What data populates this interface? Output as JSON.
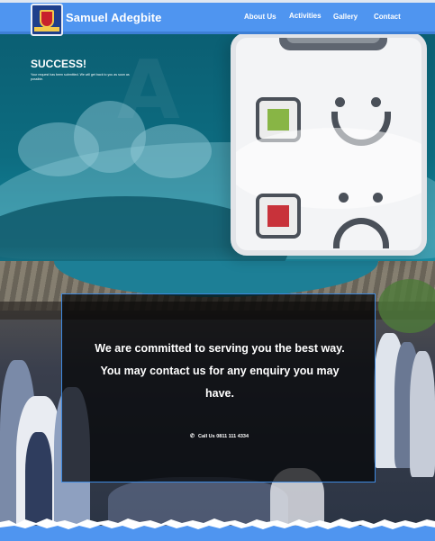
{
  "brand": {
    "name": "Samuel Adegbite",
    "logo_icon": "school-crest-icon"
  },
  "nav": {
    "items": [
      {
        "label": "About Us"
      },
      {
        "label": "Activities"
      },
      {
        "label": "Gallery"
      },
      {
        "label": "Contact"
      }
    ]
  },
  "success": {
    "title": "SUCCESS!",
    "message": "Your request has been submitted. We will get back to you as soon as possible."
  },
  "info": {
    "text": "We are committed to serving you the best way. You may contact us for any enquiry you may have.",
    "phone": "Call Us 0811 111 4334",
    "phone_icon": "phone-icon"
  },
  "colors": {
    "navbar": "#4f95f0",
    "hero": "#0d6c80",
    "info_border": "#3f8ae0",
    "thumb_up": "#88b545",
    "thumb_down": "#c8323a"
  }
}
